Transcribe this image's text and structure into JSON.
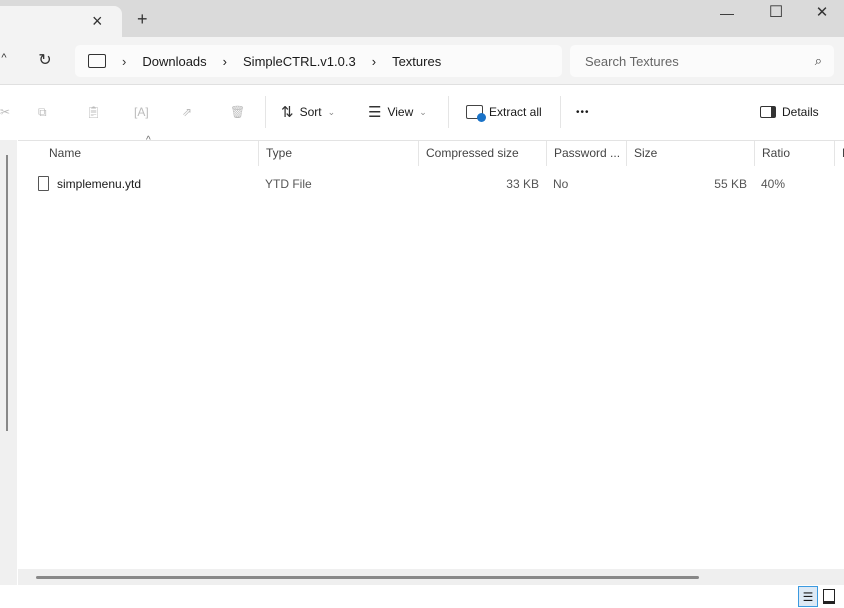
{
  "tabbar": {
    "close_icon": "×",
    "new_tab": "+"
  },
  "window": {
    "minimize": "—",
    "maximize": "☐",
    "close": "✕"
  },
  "breadcrumb": [
    "Downloads",
    "SimpleCTRL.v1.0.3",
    "Textures"
  ],
  "search": {
    "placeholder": "Search Textures"
  },
  "toolbar": {
    "sort": "Sort",
    "view": "View",
    "extract": "Extract all",
    "more": "•••",
    "details": "Details"
  },
  "columns": [
    "Name",
    "Type",
    "Compressed size",
    "Password ...",
    "Size",
    "Ratio",
    "D"
  ],
  "files": [
    {
      "name": "simplemenu.ytd",
      "type": "YTD File",
      "compressed": "33 KB",
      "password": "No",
      "size": "55 KB",
      "ratio": "40%"
    }
  ]
}
